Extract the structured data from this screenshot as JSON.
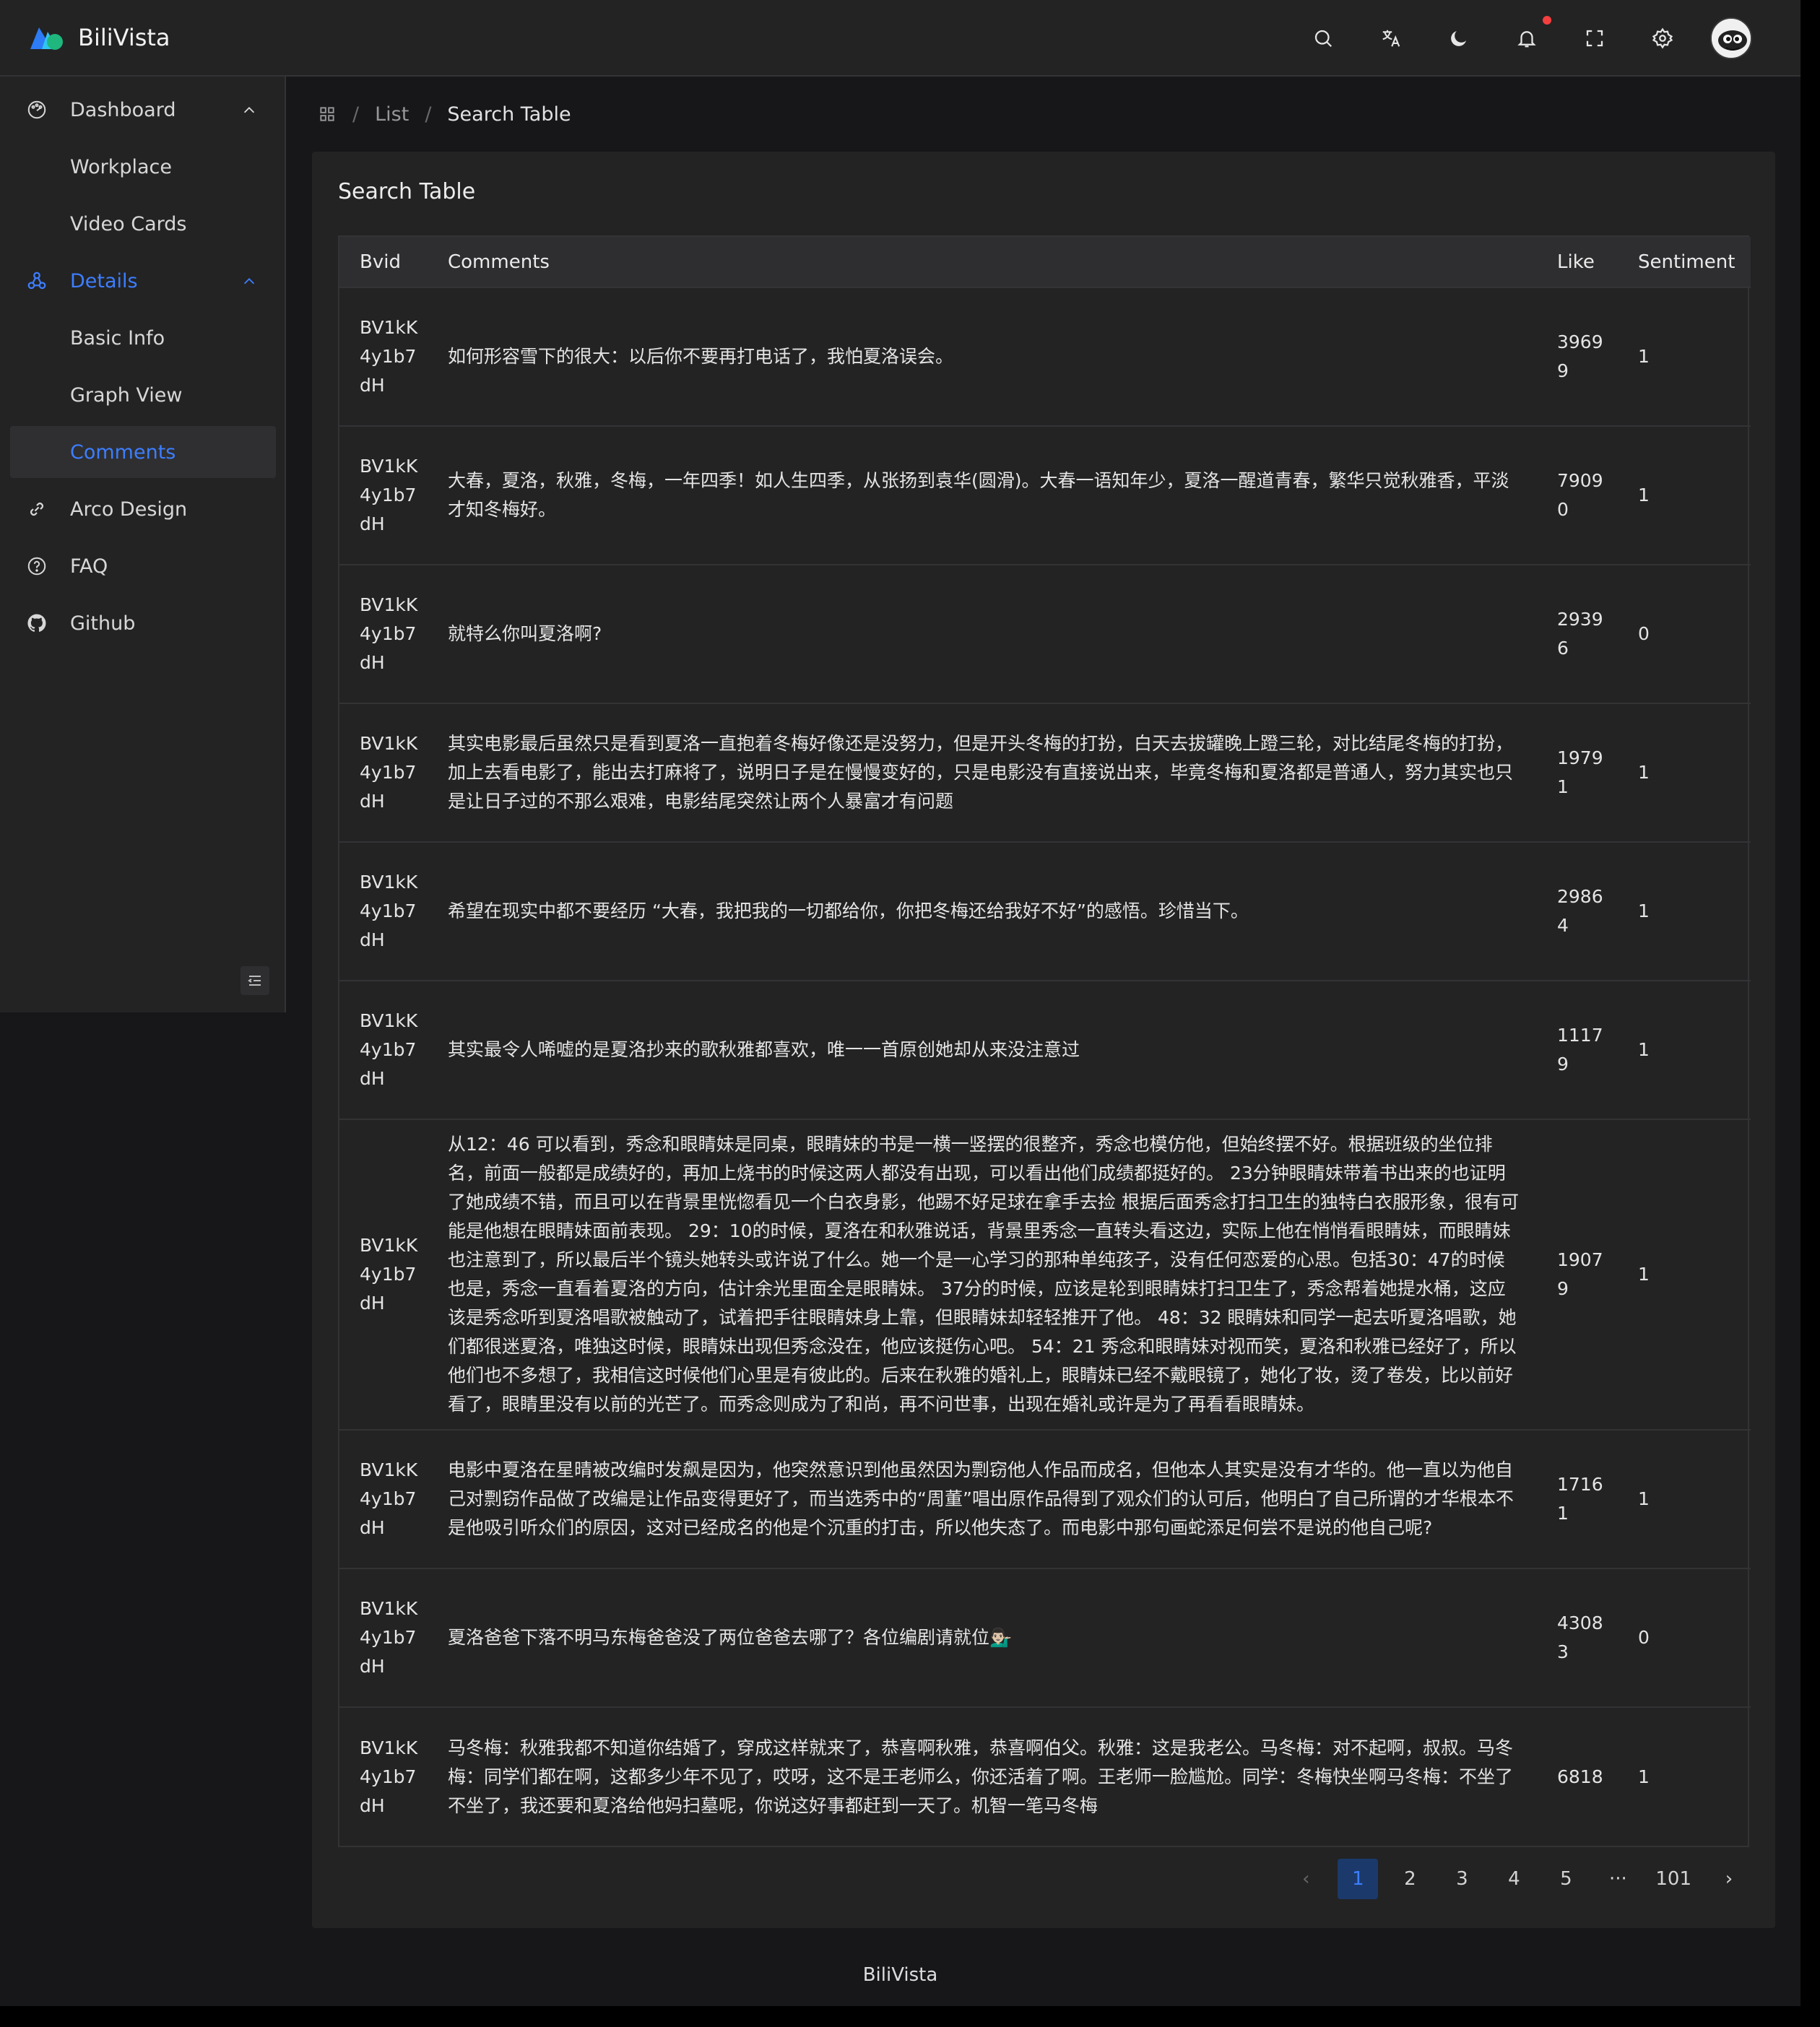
{
  "app": {
    "brand": "BiliVista"
  },
  "header": {
    "icons": [
      "search-icon",
      "translate-icon",
      "moon-icon",
      "bell-icon",
      "fullscreen-icon",
      "gear-icon"
    ],
    "notification_dot_color": "#f53f3f"
  },
  "sidebar": {
    "items": [
      {
        "label": "Dashboard",
        "icon": "dashboard-icon",
        "expanded": true
      },
      {
        "label": "Workplace"
      },
      {
        "label": "Video Cards"
      },
      {
        "label": "Details",
        "icon": "details-icon",
        "expanded": true
      },
      {
        "label": "Basic Info"
      },
      {
        "label": "Graph View"
      },
      {
        "label": "Comments",
        "selected": true
      },
      {
        "label": "Arco Design",
        "icon": "link-icon"
      },
      {
        "label": "FAQ",
        "icon": "question-icon"
      },
      {
        "label": "Github",
        "icon": "github-icon"
      }
    ]
  },
  "breadcrumb": {
    "items": [
      "List",
      "Search Table"
    ]
  },
  "card": {
    "title": "Search Table"
  },
  "table": {
    "columns": [
      "Bvid",
      "Comments",
      "Like",
      "Sentiment"
    ],
    "rows": [
      {
        "bvid": "BV1kK4y1b7dH",
        "comment": "如何形容雪下的很大：以后你不要再打电话了，我怕夏洛误会。",
        "like": "39699",
        "sentiment": "1"
      },
      {
        "bvid": "BV1kK4y1b7dH",
        "comment": "大春，夏洛，秋雅，冬梅，一年四季！如人生四季，从张扬到袁华(圆滑)。大春一语知年少，夏洛一醒道青春，繁华只觉秋雅香，平淡才知冬梅好。",
        "like": "79090",
        "sentiment": "1"
      },
      {
        "bvid": "BV1kK4y1b7dH",
        "comment": "就特么你叫夏洛啊?",
        "like": "29396",
        "sentiment": "0"
      },
      {
        "bvid": "BV1kK4y1b7dH",
        "comment": "其实电影最后虽然只是看到夏洛一直抱着冬梅好像还是没努力，但是开头冬梅的打扮，白天去拔罐晚上蹬三轮，对比结尾冬梅的打扮，加上去看电影了，能出去打麻将了，说明日子是在慢慢变好的，只是电影没有直接说出来，毕竟冬梅和夏洛都是普通人，努力其实也只是让日子过的不那么艰难，电影结尾突然让两个人暴富才有问题",
        "like": "19791",
        "sentiment": "1"
      },
      {
        "bvid": "BV1kK4y1b7dH",
        "comment": "希望在现实中都不要经历 “大春，我把我的一切都给你，你把冬梅还给我好不好”的感悟。珍惜当下。",
        "like": "29864",
        "sentiment": "1"
      },
      {
        "bvid": "BV1kK4y1b7dH",
        "comment": "其实最令人唏嘘的是夏洛抄来的歌秋雅都喜欢，唯一一首原创她却从来没注意过",
        "like": "11179",
        "sentiment": "1"
      },
      {
        "bvid": "BV1kK4y1b7dH",
        "comment": "从12：46 可以看到，秀念和眼睛妹是同桌，眼睛妹的书是一横一竖摆的很整齐，秀念也模仿他，但始终摆不好。根据班级的坐位排名，前面一般都是成绩好的，再加上烧书的时候这两人都没有出现，可以看出他们成绩都挺好的。 23分钟眼睛妹带着书出来的也证明了她成绩不错，而且可以在背景里恍惚看见一个白衣身影，他踢不好足球在拿手去捡 根据后面秀念打扫卫生的独特白衣服形象，很有可能是他想在眼睛妹面前表现。 29：10的时候，夏洛在和秋雅说话，背景里秀念一直转头看这边，实际上他在悄悄看眼睛妹，而眼睛妹也注意到了，所以最后半个镜头她转头或许说了什么。她一个是一心学习的那种单纯孩子，没有任何恋爱的心思。包括30：47的时候也是，秀念一直看着夏洛的方向，估计余光里面全是眼睛妹。 37分的时候，应该是轮到眼睛妹打扫卫生了，秀念帮着她提水桶，这应该是秀念听到夏洛唱歌被触动了，试着把手往眼睛妹身上靠，但眼睛妹却轻轻推开了他。 48：32 眼睛妹和同学一起去听夏洛唱歌，她们都很迷夏洛，唯独这时候，眼睛妹出现但秀念没在，他应该挺伤心吧。 54：21 秀念和眼睛妹对视而笑，夏洛和秋雅已经好了，所以他们也不多想了，我相信这时候他们心里是有彼此的。后来在秋雅的婚礼上，眼睛妹已经不戴眼镜了，她化了妆，烫了卷发，比以前好看了，眼睛里没有以前的光芒了。而秀念则成为了和尚，再不问世事，出现在婚礼或许是为了再看看眼睛妹。",
        "like": "19079",
        "sentiment": "1"
      },
      {
        "bvid": "BV1kK4y1b7dH",
        "comment": "电影中夏洛在星晴被改编时发飙是因为，他突然意识到他虽然因为剽窃他人作品而成名，但他本人其实是没有才华的。他一直以为他自己对剽窃作品做了改编是让作品变得更好了，而当选秀中的“周董”唱出原作品得到了观众们的认可后，他明白了自己所谓的才华根本不是他吸引听众们的原因，这对已经成名的他是个沉重的打击，所以他失态了。而电影中那句画蛇添足何尝不是说的他自己呢?",
        "like": "17161",
        "sentiment": "1"
      },
      {
        "bvid": "BV1kK4y1b7dH",
        "comment": "夏洛爸爸下落不明马东梅爸爸没了两位爸爸去哪了？各位编剧请就位💁🏻‍♂️",
        "like": "43083",
        "sentiment": "0"
      },
      {
        "bvid": "BV1kK4y1b7dH",
        "comment": "马冬梅：秋雅我都不知道你结婚了，穿成这样就来了，恭喜啊秋雅，恭喜啊伯父。秋雅：这是我老公。马冬梅：对不起啊，叔叔。马冬梅：同学们都在啊，这都多少年不见了，哎呀，这不是王老师么，你还活着了啊。王老师一脸尴尬。同学：冬梅快坐啊马冬梅：不坐了不坐了，我还要和夏洛给他妈扫墓呢，你说这好事都赶到一天了。机智一笔马冬梅",
        "like": "6818",
        "sentiment": "1"
      }
    ]
  },
  "pagination": {
    "prev": "‹",
    "pages": [
      "1",
      "2",
      "3",
      "4",
      "5"
    ],
    "ellipsis": "···",
    "last": "101",
    "next": "›",
    "current": "1"
  },
  "footer": {
    "text": "BiliVista"
  },
  "colors": {
    "accent": "#3c7eff",
    "background": "#17171a",
    "panel": "#232324"
  }
}
